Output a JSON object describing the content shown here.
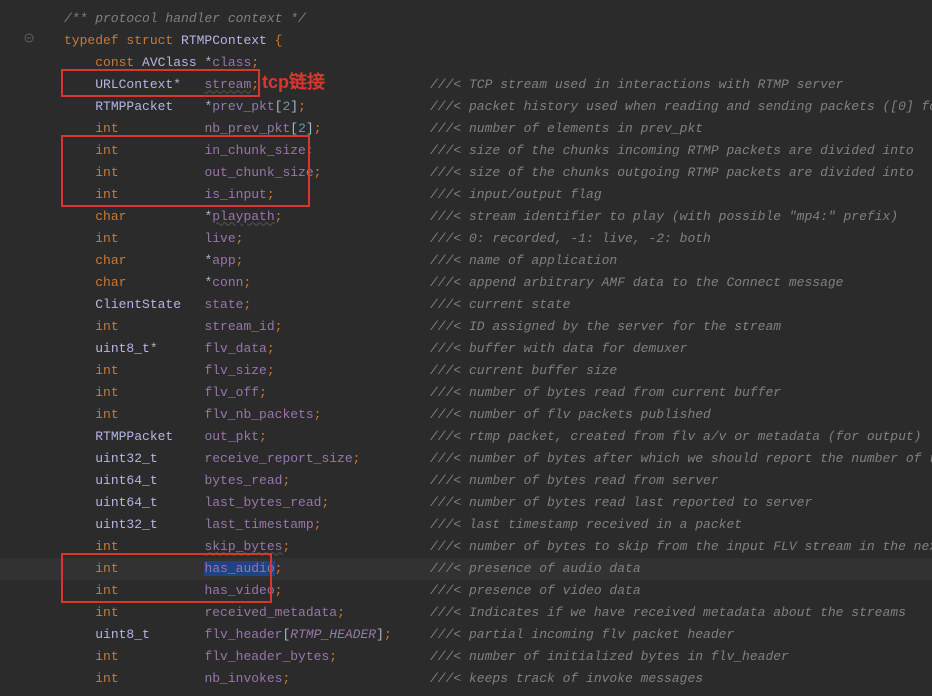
{
  "annotation": {
    "label": "tcp链接"
  },
  "lines": [
    {
      "indent": 0,
      "cls": "comment",
      "raw": "/** protocol handler context */"
    },
    {
      "indent": 0,
      "segs": [
        [
          "kw",
          "typedef "
        ],
        [
          "kw",
          "struct "
        ],
        [
          "typename",
          "RTMPContext "
        ],
        [
          "punct",
          "{"
        ]
      ]
    },
    {
      "indent": 1,
      "segs": [
        [
          "kw",
          "const "
        ],
        [
          "typename",
          "AVClass "
        ],
        [
          "ptr",
          "*"
        ],
        [
          "field",
          "class"
        ],
        [
          "punct",
          ";"
        ]
      ]
    },
    {
      "indent": 1,
      "segs": [
        [
          "typename",
          "URLContext"
        ],
        [
          "ptr",
          "*   "
        ],
        [
          "field-u",
          "stream"
        ],
        [
          "punct",
          ";"
        ]
      ],
      "comment": "///< TCP stream used in interactions with RTMP server"
    },
    {
      "indent": 1,
      "segs": [
        [
          "typename",
          "RTMPPacket    "
        ],
        [
          "ptr",
          "*"
        ],
        [
          "field",
          "prev_pkt"
        ],
        [
          "ptr",
          "["
        ],
        [
          "num",
          "2"
        ],
        [
          "ptr",
          "]"
        ],
        [
          "punct",
          ";"
        ]
      ],
      "comment": "///< packet history used when reading and sending packets ([0] fo"
    },
    {
      "indent": 1,
      "segs": [
        [
          "kw",
          "int           "
        ],
        [
          "field",
          "nb_prev_pkt"
        ],
        [
          "ptr",
          "["
        ],
        [
          "num",
          "2"
        ],
        [
          "ptr",
          "]"
        ],
        [
          "punct",
          ";"
        ]
      ],
      "comment": "///< number of elements in prev_pkt"
    },
    {
      "indent": 1,
      "segs": [
        [
          "kw",
          "int           "
        ],
        [
          "field",
          "in_chunk_size"
        ],
        [
          "punct",
          ";"
        ]
      ],
      "comment": "///< size of the chunks incoming RTMP packets are divided into"
    },
    {
      "indent": 1,
      "segs": [
        [
          "kw",
          "int           "
        ],
        [
          "field",
          "out_chunk_size"
        ],
        [
          "punct",
          ";"
        ]
      ],
      "comment": "///< size of the chunks outgoing RTMP packets are divided into"
    },
    {
      "indent": 1,
      "segs": [
        [
          "kw",
          "int           "
        ],
        [
          "field",
          "is_input"
        ],
        [
          "punct",
          ";"
        ]
      ],
      "comment": "///< input/output flag"
    },
    {
      "indent": 1,
      "segs": [
        [
          "kw",
          "char          "
        ],
        [
          "ptr",
          "*"
        ],
        [
          "field-u",
          "playpath"
        ],
        [
          "punct",
          ";"
        ]
      ],
      "comment": "///< stream identifier to play (with possible \"mp4:\" prefix)"
    },
    {
      "indent": 1,
      "segs": [
        [
          "kw",
          "int           "
        ],
        [
          "field",
          "live"
        ],
        [
          "punct",
          ";"
        ]
      ],
      "comment": "///< 0: recorded, -1: live, -2: both"
    },
    {
      "indent": 1,
      "segs": [
        [
          "kw",
          "char          "
        ],
        [
          "ptr",
          "*"
        ],
        [
          "field",
          "app"
        ],
        [
          "punct",
          ";"
        ]
      ],
      "comment": "///< name of application"
    },
    {
      "indent": 1,
      "segs": [
        [
          "kw",
          "char          "
        ],
        [
          "ptr",
          "*"
        ],
        [
          "field",
          "conn"
        ],
        [
          "punct",
          ";"
        ]
      ],
      "comment": "///< append arbitrary AMF data to the Connect message"
    },
    {
      "indent": 1,
      "segs": [
        [
          "typename",
          "ClientState   "
        ],
        [
          "field",
          "state"
        ],
        [
          "punct",
          ";"
        ]
      ],
      "comment": "///< current state"
    },
    {
      "indent": 1,
      "segs": [
        [
          "kw",
          "int           "
        ],
        [
          "field",
          "stream_id"
        ],
        [
          "punct",
          ";"
        ]
      ],
      "comment": "///< ID assigned by the server for the stream"
    },
    {
      "indent": 1,
      "segs": [
        [
          "typename",
          "uint8_t"
        ],
        [
          "ptr",
          "*      "
        ],
        [
          "field",
          "flv_data"
        ],
        [
          "punct",
          ";"
        ]
      ],
      "comment": "///< buffer with data for demuxer"
    },
    {
      "indent": 1,
      "segs": [
        [
          "kw",
          "int           "
        ],
        [
          "field",
          "flv_size"
        ],
        [
          "punct",
          ";"
        ]
      ],
      "comment": "///< current buffer size"
    },
    {
      "indent": 1,
      "segs": [
        [
          "kw",
          "int           "
        ],
        [
          "field",
          "flv_off"
        ],
        [
          "punct",
          ";"
        ]
      ],
      "comment": "///< number of bytes read from current buffer"
    },
    {
      "indent": 1,
      "segs": [
        [
          "kw",
          "int           "
        ],
        [
          "field",
          "flv_nb_packets"
        ],
        [
          "punct",
          ";"
        ]
      ],
      "comment": "///< number of flv packets published"
    },
    {
      "indent": 1,
      "segs": [
        [
          "typename",
          "RTMPPacket    "
        ],
        [
          "field",
          "out_pkt"
        ],
        [
          "punct",
          ";"
        ]
      ],
      "comment": "///< rtmp packet, created from flv a/v or metadata (for output)"
    },
    {
      "indent": 1,
      "segs": [
        [
          "typename",
          "uint32_t      "
        ],
        [
          "field",
          "receive_report_size"
        ],
        [
          "punct",
          ";"
        ]
      ],
      "comment": "///< number of bytes after which we should report the number of re"
    },
    {
      "indent": 1,
      "segs": [
        [
          "typename",
          "uint64_t      "
        ],
        [
          "field",
          "bytes_read"
        ],
        [
          "punct",
          ";"
        ]
      ],
      "comment": "///< number of bytes read from server"
    },
    {
      "indent": 1,
      "segs": [
        [
          "typename",
          "uint64_t      "
        ],
        [
          "field",
          "last_bytes_read"
        ],
        [
          "punct",
          ";"
        ]
      ],
      "comment": "///< number of bytes read last reported to server"
    },
    {
      "indent": 1,
      "segs": [
        [
          "typename",
          "uint32_t      "
        ],
        [
          "field",
          "last_timestamp"
        ],
        [
          "punct",
          ";"
        ]
      ],
      "comment": "///< last timestamp received in a packet"
    },
    {
      "indent": 1,
      "segs": [
        [
          "kw",
          "int           "
        ],
        [
          "field-u",
          "skip_bytes"
        ],
        [
          "punct",
          ";"
        ]
      ],
      "comment": "///< number of bytes to skip from the input FLV stream in the next"
    },
    {
      "indent": 1,
      "segs": [
        [
          "kw",
          "int           "
        ],
        [
          "field",
          "has_audio",
          "sel"
        ],
        [
          "punct",
          ";"
        ]
      ],
      "comment": "///< presence of audio data",
      "hl": true
    },
    {
      "indent": 1,
      "segs": [
        [
          "kw",
          "int           "
        ],
        [
          "field",
          "has_video"
        ],
        [
          "punct",
          ";"
        ]
      ],
      "comment": "///< presence of video data"
    },
    {
      "indent": 1,
      "segs": [
        [
          "kw",
          "int           "
        ],
        [
          "field",
          "received_metadata"
        ],
        [
          "punct",
          ";"
        ]
      ],
      "comment": "///< Indicates if we have received metadata about the streams"
    },
    {
      "indent": 1,
      "segs": [
        [
          "typename",
          "uint8_t       "
        ],
        [
          "field",
          "flv_header"
        ],
        [
          "ptr",
          "["
        ],
        [
          "const",
          "RTMP_HEADER"
        ],
        [
          "ptr",
          "]"
        ],
        [
          "punct",
          ";"
        ]
      ],
      "comment": "///< partial incoming flv packet header"
    },
    {
      "indent": 1,
      "segs": [
        [
          "kw",
          "int           "
        ],
        [
          "field",
          "flv_header_bytes"
        ],
        [
          "punct",
          ";"
        ]
      ],
      "comment": "///< number of initialized bytes in flv_header"
    },
    {
      "indent": 1,
      "segs": [
        [
          "kw",
          "int           "
        ],
        [
          "field",
          "nb_invokes"
        ],
        [
          "punct",
          ";"
        ]
      ],
      "comment": "///< keeps track of invoke messages"
    }
  ]
}
